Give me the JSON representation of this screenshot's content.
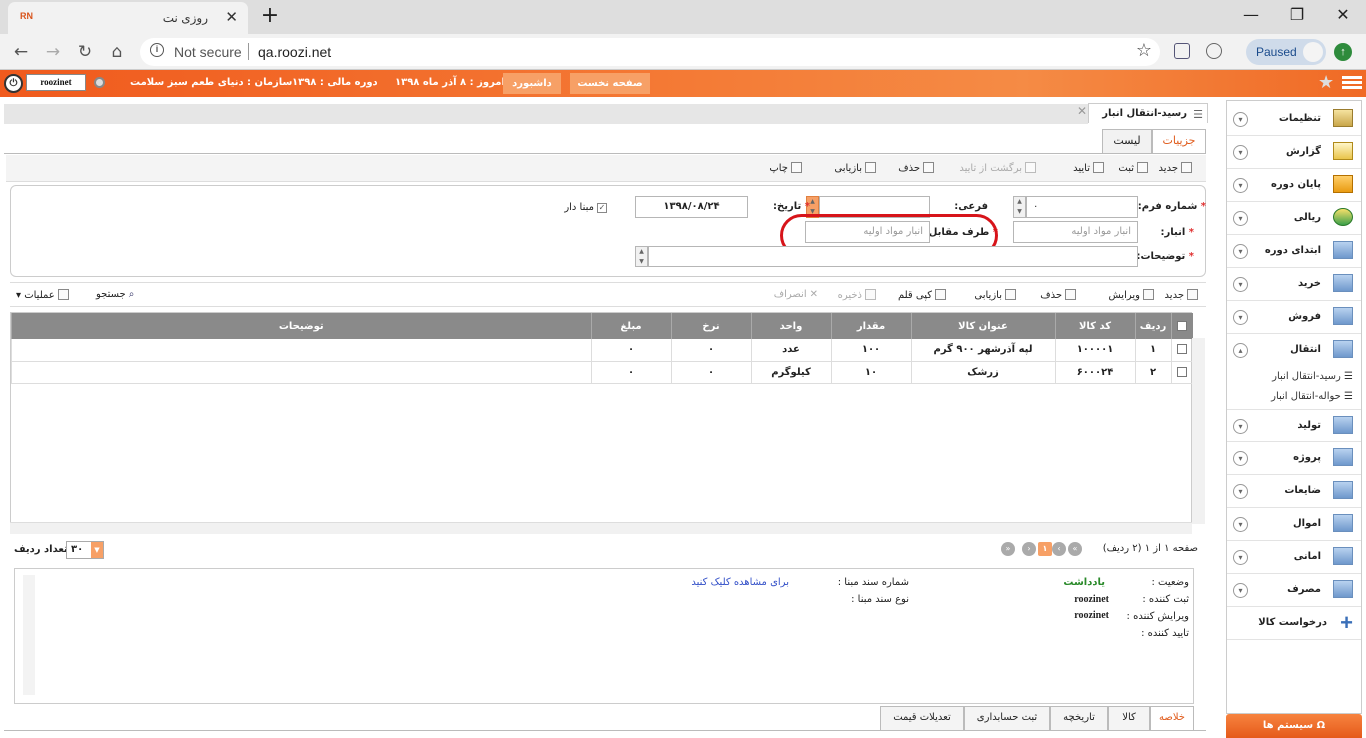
{
  "browser": {
    "tab_title": "روزی نت",
    "tab_favicon": "RN",
    "not_secure": "Not secure",
    "url": "qa.roozi.net",
    "paused": "Paused"
  },
  "header": {
    "user": "roozinet",
    "org_label": "سازمان : دنیای طعم سبز سلامت",
    "fiscal_label": "دوره مالی : ۱۳۹۸",
    "today_label": "امروز : ۸ آذر ماه ۱۳۹۸",
    "dashboard": "داشبورد",
    "home": "صفحه نخست"
  },
  "page_tab": "رسید-انتقال انبار",
  "subtabs": {
    "details": "جزییات",
    "list": "لیست"
  },
  "toolbar1": {
    "new": "جدید",
    "save": "ثبت",
    "approve": "تایید",
    "unapprove": "برگشت از تایید",
    "delete": "حذف",
    "refresh": "بازیابی",
    "print": "چاپ"
  },
  "form": {
    "form_no_label": "شماره فرم:",
    "form_no_value": "۰",
    "sub_label": "فرعی:",
    "date_label": "تاریخ:",
    "date_value": "۱۳۹۸/۰۸/۲۴",
    "based_label": "مبنا دار",
    "warehouse_label": "انبار:",
    "warehouse_value": "انبار مواد اولیه",
    "counter_label": "طرف مقابل:",
    "counter_value": "انبار مواد اولیه",
    "desc_label": "توضیحات:"
  },
  "toolbar2": {
    "new": "جدید",
    "edit": "ویرایش",
    "delete": "حذف",
    "refresh": "بازیابی",
    "copy": "کپی قلم",
    "save": "ذخیره",
    "cancel": "انصراف",
    "search": "جستجو",
    "ops": "عملیات"
  },
  "grid": {
    "headers": [
      "ردیف",
      "کد کالا",
      "عنوان کالا",
      "مقدار",
      "واحد",
      "نرخ",
      "مبلغ",
      "توضیحات"
    ],
    "rows": [
      [
        "۱",
        "۱۰۰۰۰۱",
        "لپه آذرشهر ۹۰۰ گرم",
        "۱۰۰",
        "عدد",
        "۰",
        "۰",
        ""
      ],
      [
        "۲",
        "۶۰۰۰۲۴",
        "زرشک",
        "۱۰",
        "کیلوگرم",
        "۰",
        "۰",
        ""
      ]
    ]
  },
  "pager": {
    "info": "صفحه ۱ از ۱ (۲ ردیف)",
    "current_page": "۱",
    "page_size": "۳۰",
    "page_size_label": "تعداد ردیف"
  },
  "summary": {
    "status_label": "وضعیت :",
    "status_value": "یادداشت",
    "creator_label": "ثبت کننده :",
    "creator_value": "roozinet",
    "editor_label": "ویرایش کننده :",
    "editor_value": "roozinet",
    "approver_label": "تایید کننده :",
    "ref_no_label": "شماره سند مبنا :",
    "ref_type_label": "نوع سند مبنا :",
    "click_view": "برای مشاهده کلیک کنید"
  },
  "bottom_tabs": [
    "خلاصه",
    "کالا",
    "تاریخچه",
    "ثبت حسابداری",
    "تعدیلات قیمت"
  ],
  "sidebar": {
    "items": [
      "تنظیمات",
      "گزارش",
      "پایان دوره",
      "ریالی",
      "ابتدای دوره",
      "خرید",
      "فروش",
      "انتقال",
      "تولید",
      "پروژه",
      "ضایعات",
      "اموال",
      "امانی",
      "مصرف",
      "درخواست کالا"
    ],
    "sub_items": [
      "رسید-انتقال انبار",
      "حواله-انتقال انبار"
    ],
    "system": "سیستم ها"
  }
}
